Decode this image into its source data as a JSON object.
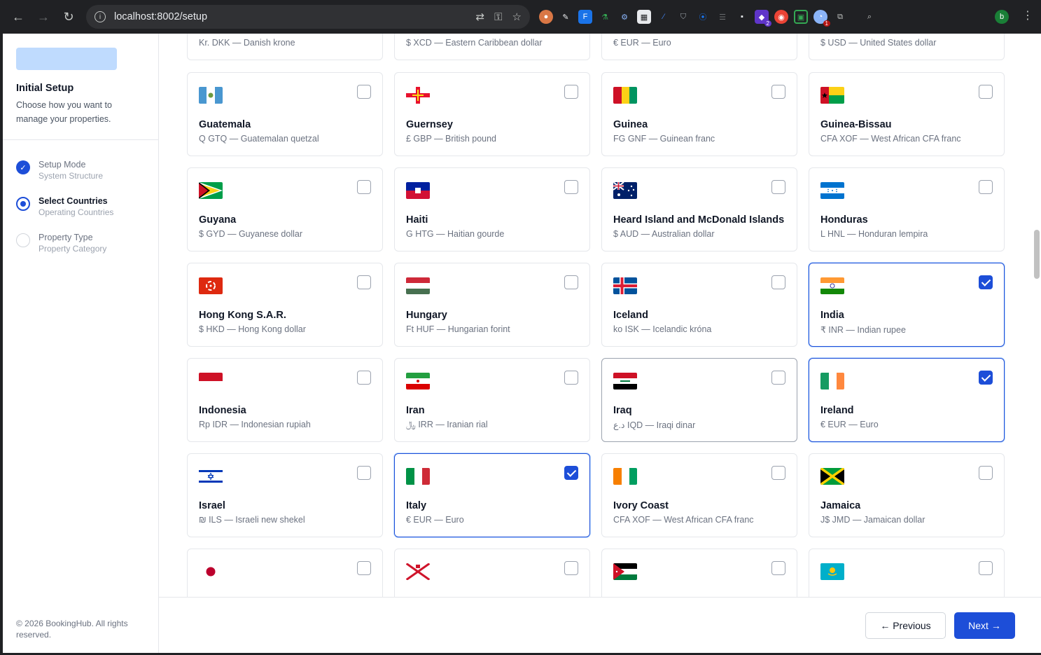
{
  "browser": {
    "url": "localhost:8002/setup",
    "profile_initial": "b",
    "extension_badges": [
      "2",
      "1"
    ]
  },
  "sidebar": {
    "title": "Initial Setup",
    "description": "Choose how you want to manage your properties.",
    "steps": [
      {
        "name": "Setup Mode",
        "sub": "System Structure",
        "state": "done"
      },
      {
        "name": "Select Countries",
        "sub": "Operating Countries",
        "state": "active"
      },
      {
        "name": "Property Type",
        "sub": "Property Category",
        "state": "todo"
      }
    ],
    "copyright": "© 2026 BookingHub. All rights reserved."
  },
  "countries": [
    {
      "name": "",
      "currency": "Kr. DKK — Danish krone",
      "checked": false,
      "flag": "none"
    },
    {
      "name": "",
      "currency": "$ XCD — Eastern Caribbean dollar",
      "checked": false,
      "flag": "none"
    },
    {
      "name": "",
      "currency": "€ EUR — Euro",
      "checked": false,
      "flag": "none"
    },
    {
      "name": "",
      "currency": "$ USD — United States dollar",
      "checked": false,
      "flag": "none"
    },
    {
      "name": "Guatemala",
      "currency": "Q GTQ — Guatemalan quetzal",
      "checked": false,
      "flag": "guatemala"
    },
    {
      "name": "Guernsey",
      "currency": "£ GBP — British pound",
      "checked": false,
      "flag": "guernsey"
    },
    {
      "name": "Guinea",
      "currency": "FG GNF — Guinean franc",
      "checked": false,
      "flag": "guinea"
    },
    {
      "name": "Guinea-Bissau",
      "currency": "CFA XOF — West African CFA franc",
      "checked": false,
      "flag": "guinea-bissau"
    },
    {
      "name": "Guyana",
      "currency": "$ GYD — Guyanese dollar",
      "checked": false,
      "flag": "guyana"
    },
    {
      "name": "Haiti",
      "currency": "G HTG — Haitian gourde",
      "checked": false,
      "flag": "haiti"
    },
    {
      "name": "Heard Island and McDonald Islands",
      "currency": "$ AUD — Australian dollar",
      "checked": false,
      "flag": "australia"
    },
    {
      "name": "Honduras",
      "currency": "L HNL — Honduran lempira",
      "checked": false,
      "flag": "honduras"
    },
    {
      "name": "Hong Kong S.A.R.",
      "currency": "$ HKD — Hong Kong dollar",
      "checked": false,
      "flag": "hongkong"
    },
    {
      "name": "Hungary",
      "currency": "Ft HUF — Hungarian forint",
      "checked": false,
      "flag": "hungary"
    },
    {
      "name": "Iceland",
      "currency": "ko ISK — Icelandic króna",
      "checked": false,
      "flag": "iceland"
    },
    {
      "name": "India",
      "currency": "₹ INR — Indian rupee",
      "checked": true,
      "flag": "india"
    },
    {
      "name": "Indonesia",
      "currency": "Rp IDR — Indonesian rupiah",
      "checked": false,
      "flag": "indonesia"
    },
    {
      "name": "Iran",
      "currency": "﷼ IRR — Iranian rial",
      "checked": false,
      "flag": "iran"
    },
    {
      "name": "Iraq",
      "currency": "د.ع IQD — Iraqi dinar",
      "checked": false,
      "flag": "iraq"
    },
    {
      "name": "Ireland",
      "currency": "€ EUR — Euro",
      "checked": true,
      "flag": "ireland"
    },
    {
      "name": "Israel",
      "currency": "₪ ILS — Israeli new shekel",
      "checked": false,
      "flag": "israel"
    },
    {
      "name": "Italy",
      "currency": "€ EUR — Euro",
      "checked": true,
      "flag": "italy"
    },
    {
      "name": "Ivory Coast",
      "currency": "CFA XOF — West African CFA franc",
      "checked": false,
      "flag": "ivorycoast"
    },
    {
      "name": "Jamaica",
      "currency": "J$ JMD — Jamaican dollar",
      "checked": false,
      "flag": "jamaica"
    },
    {
      "name": "",
      "currency": "",
      "checked": false,
      "flag": "japan"
    },
    {
      "name": "",
      "currency": "",
      "checked": false,
      "flag": "jersey"
    },
    {
      "name": "",
      "currency": "",
      "checked": false,
      "flag": "jordan"
    },
    {
      "name": "",
      "currency": "",
      "checked": false,
      "flag": "kazakhstan"
    }
  ],
  "footer": {
    "previous_label": "← Previous",
    "next_label": "Next →"
  },
  "colors": {
    "primary": "#1d4ed8",
    "logo_placeholder": "#bfdbfe"
  }
}
